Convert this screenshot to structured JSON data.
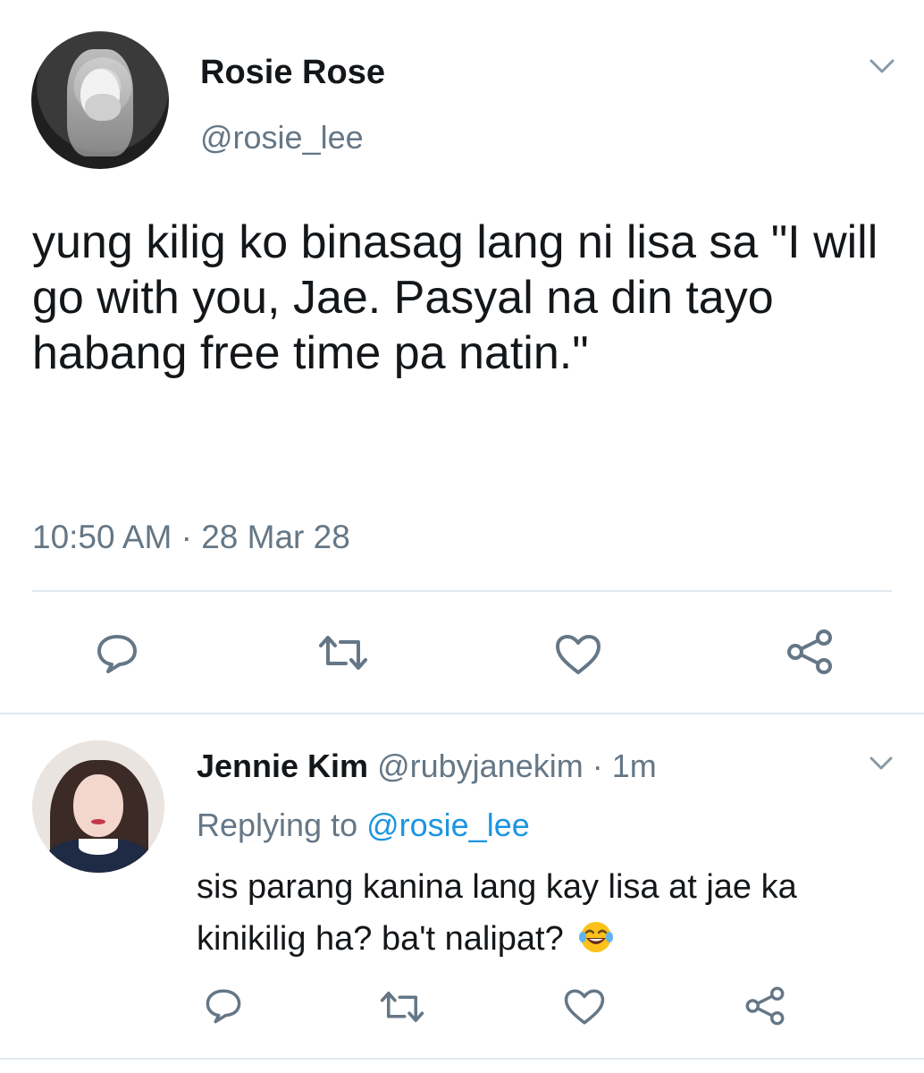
{
  "main_tweet": {
    "author_name": "Rosie Rose",
    "author_handle": "@rosie_lee",
    "text": "yung kilig ko binasag lang ni lisa sa \"I will go with you, Jae. Pasyal na din tayo habang free time pa natin.\"",
    "timestamp": "10:50 AM · 28 Mar 28",
    "actions": [
      "reply-icon",
      "retweet-icon",
      "like-icon",
      "share-icon"
    ]
  },
  "reply_tweet": {
    "author_name": "Jennie Kim",
    "author_handle": "@rubyjanekim",
    "separator": " · ",
    "time_ago": "1m",
    "replying_to_label": "Replying to ",
    "replying_to_handle": "@rosie_lee",
    "text": "sis parang kanina lang kay lisa at jae ka kinikilig ha? ba't nalipat?",
    "emoji": "face-with-tears-of-joy",
    "actions": [
      "reply-icon",
      "retweet-icon",
      "like-icon",
      "share-icon"
    ]
  },
  "colors": {
    "text_primary": "#14171a",
    "text_secondary": "#657786",
    "link": "#1b95e0",
    "divider": "#e1e8ed",
    "icon": "#657786"
  }
}
